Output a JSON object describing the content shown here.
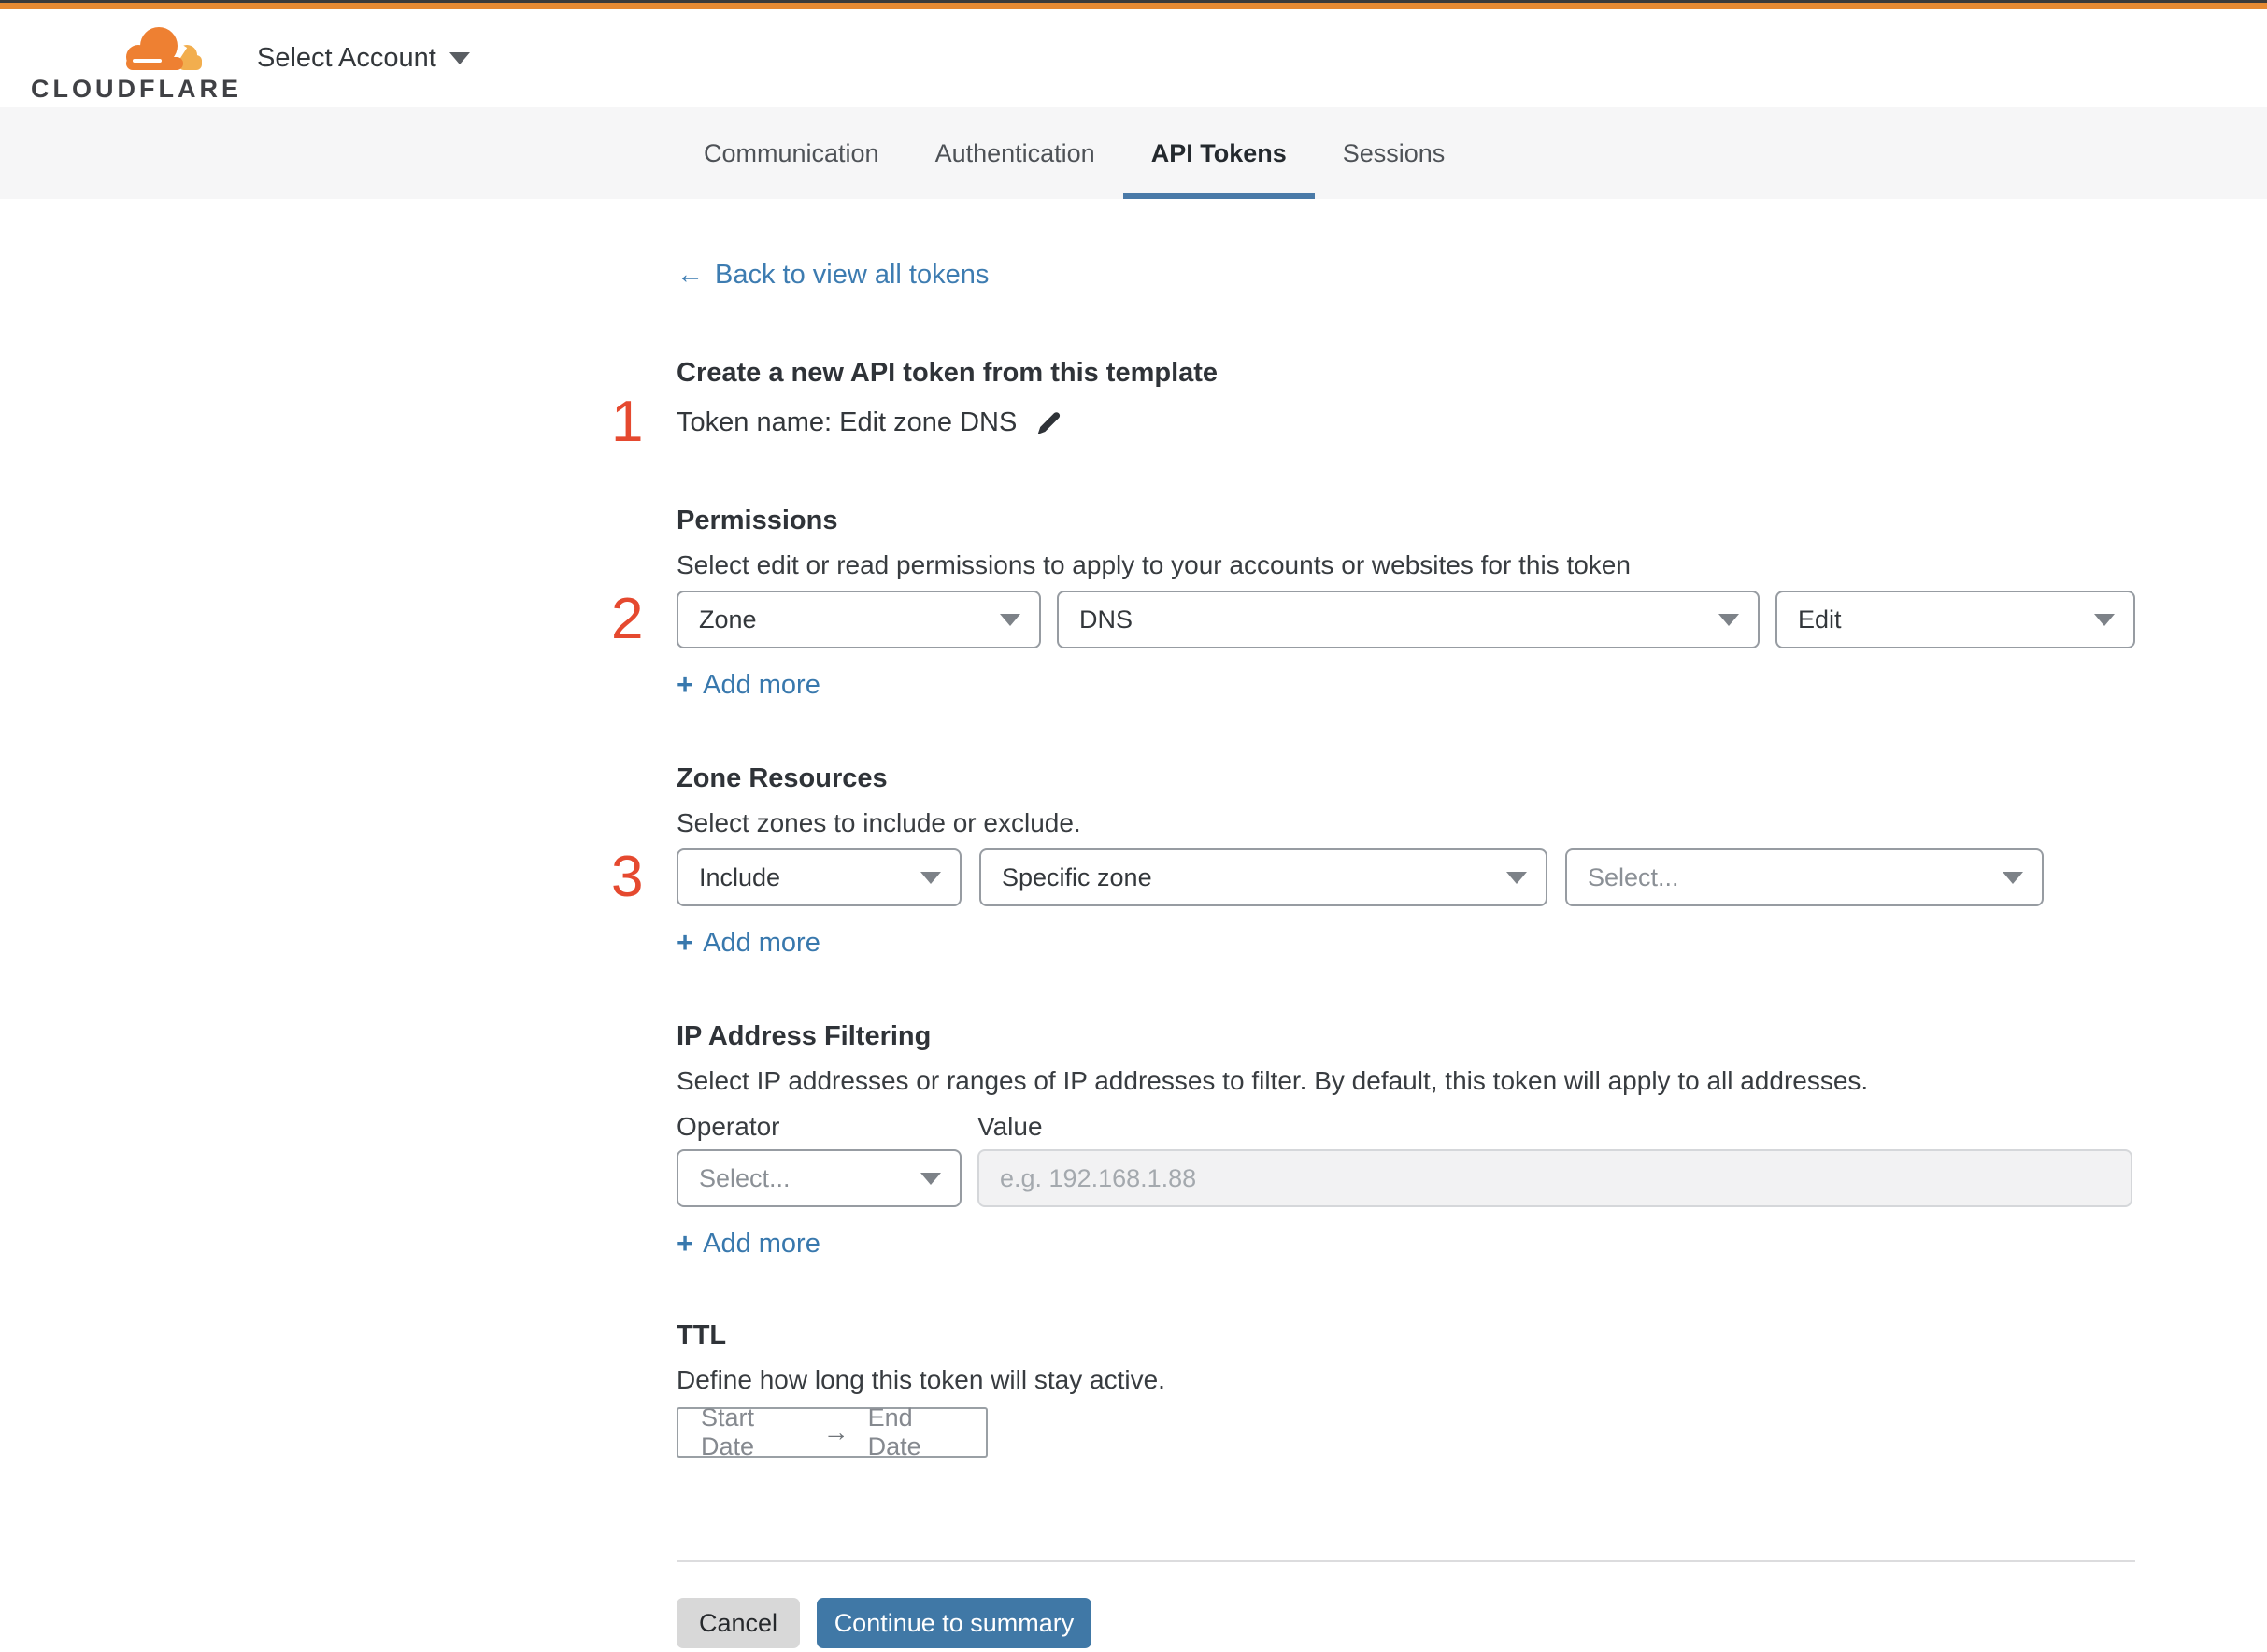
{
  "colors": {
    "accent_orange": "#e68a33",
    "link_blue": "#3d7cb1",
    "button_blue": "#4078a6",
    "tab_underline_blue": "#4a7aa8",
    "step_red": "#e5492f"
  },
  "topbar": {
    "brand": "CLOUDFLARE",
    "account_selector_label": "Select Account"
  },
  "tabs": [
    {
      "label": "Communication",
      "active": false
    },
    {
      "label": "Authentication",
      "active": false
    },
    {
      "label": "API Tokens",
      "active": true
    },
    {
      "label": "Sessions",
      "active": false
    }
  ],
  "back_link": {
    "arrow": "←",
    "label": "Back to view all tokens"
  },
  "token": {
    "step": "1",
    "heading": "Create a new API token from this template",
    "name_line": "Token name: Edit zone DNS"
  },
  "permissions": {
    "step": "2",
    "heading": "Permissions",
    "description": "Select edit or read permissions to apply to your accounts or websites for this token",
    "scope_value": "Zone",
    "service_value": "DNS",
    "access_value": "Edit",
    "plus": "+",
    "add_more": "Add more"
  },
  "zone_resources": {
    "step": "3",
    "heading": "Zone Resources",
    "description": "Select zones to include or exclude.",
    "mode_value": "Include",
    "type_value": "Specific zone",
    "zone_placeholder": "Select...",
    "plus": "+",
    "add_more": "Add more"
  },
  "ip_filtering": {
    "heading": "IP Address Filtering",
    "description": "Select IP addresses or ranges of IP addresses to filter. By default, this token will apply to all addresses.",
    "operator_label": "Operator",
    "value_label": "Value",
    "operator_placeholder": "Select...",
    "value_placeholder": "e.g. 192.168.1.88",
    "plus": "+",
    "add_more": "Add more"
  },
  "ttl": {
    "heading": "TTL",
    "description": "Define how long this token will stay active.",
    "start_label": "Start Date",
    "arrow": "→",
    "end_label": "End Date"
  },
  "footer": {
    "cancel_label": "Cancel",
    "continue_label": "Continue to summary"
  }
}
